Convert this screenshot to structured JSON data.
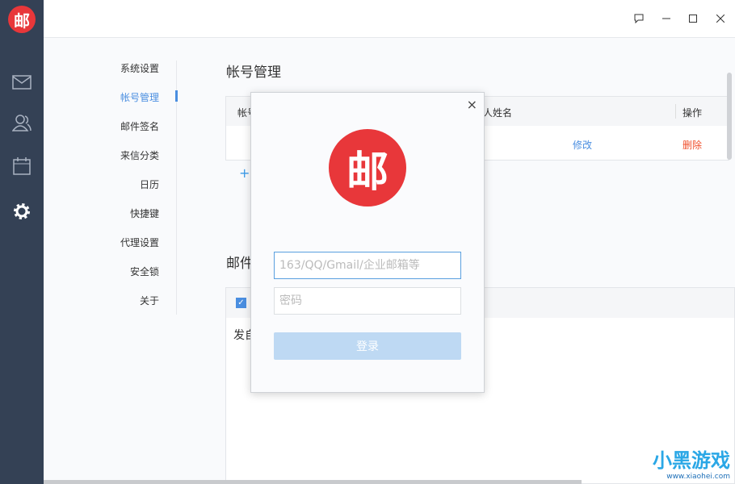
{
  "app": {
    "logo_text": "邮"
  },
  "rail": {
    "items": [
      "mail",
      "contacts",
      "calendar",
      "settings"
    ]
  },
  "window": {
    "feedback": "feedback",
    "minimize": "minimize",
    "maximize": "maximize",
    "close": "close"
  },
  "menu": {
    "items": [
      "系统设置",
      "帐号管理",
      "邮件签名",
      "来信分类",
      "日历",
      "快捷键",
      "代理设置",
      "安全锁",
      "关于"
    ],
    "active": 1
  },
  "accounts": {
    "title": "帐号管理",
    "col_account": "帐号",
    "col_name": "人姓名",
    "col_action": "操作",
    "row": {
      "edit": "修改",
      "delete": "删除"
    },
    "add": "+"
  },
  "mail_section": {
    "title": "邮件",
    "row_text": "发自"
  },
  "dialog": {
    "logo_text": "邮",
    "email_placeholder": "163/QQ/Gmail/企业邮箱等",
    "password_placeholder": "密码",
    "login": "登录",
    "close": "×"
  },
  "watermark": {
    "title": "小黑游戏",
    "url": "www.xiaohei.com"
  },
  "colors": {
    "accent": "#4a8ee0",
    "brand": "#e8373a",
    "delete": "#f0502d",
    "rail": "#344155"
  }
}
